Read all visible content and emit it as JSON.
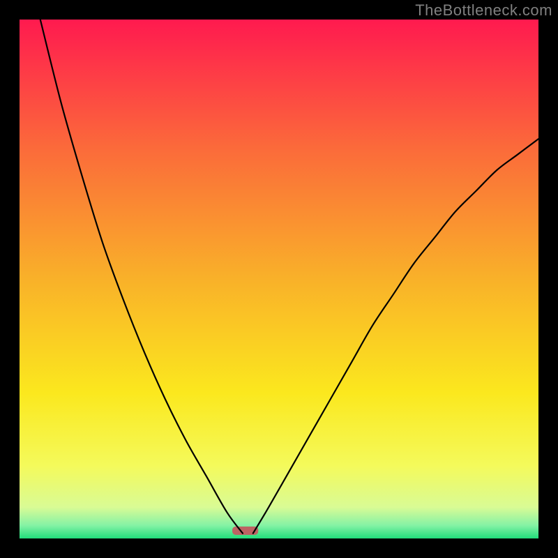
{
  "watermark": "TheBottleneck.com",
  "chart_data": {
    "type": "line",
    "title": "",
    "xlabel": "",
    "ylabel": "",
    "xlim": [
      0,
      100
    ],
    "ylim": [
      0,
      100
    ],
    "grid": false,
    "legend": false,
    "annotations": [
      {
        "name": "minimum-marker",
        "x_range": [
          41,
          46
        ],
        "y": 1.5
      }
    ],
    "gradient_stops": [
      {
        "offset": 0.0,
        "color": "#ff1a4f"
      },
      {
        "offset": 0.25,
        "color": "#fb6b3a"
      },
      {
        "offset": 0.5,
        "color": "#f9b129"
      },
      {
        "offset": 0.72,
        "color": "#fbe81e"
      },
      {
        "offset": 0.86,
        "color": "#f4fa5b"
      },
      {
        "offset": 0.94,
        "color": "#d9fb95"
      },
      {
        "offset": 0.975,
        "color": "#84f2a5"
      },
      {
        "offset": 1.0,
        "color": "#21de7b"
      }
    ],
    "series": [
      {
        "name": "left-branch",
        "x": [
          4,
          8,
          12,
          16,
          20,
          24,
          28,
          32,
          36,
          40,
          43
        ],
        "y": [
          100,
          84,
          70,
          57,
          46,
          36,
          27,
          19,
          12,
          5,
          1
        ]
      },
      {
        "name": "right-branch",
        "x": [
          45,
          48,
          52,
          56,
          60,
          64,
          68,
          72,
          76,
          80,
          84,
          88,
          92,
          96,
          100
        ],
        "y": [
          1,
          6,
          13,
          20,
          27,
          34,
          41,
          47,
          53,
          58,
          63,
          67,
          71,
          74,
          77
        ]
      }
    ]
  }
}
